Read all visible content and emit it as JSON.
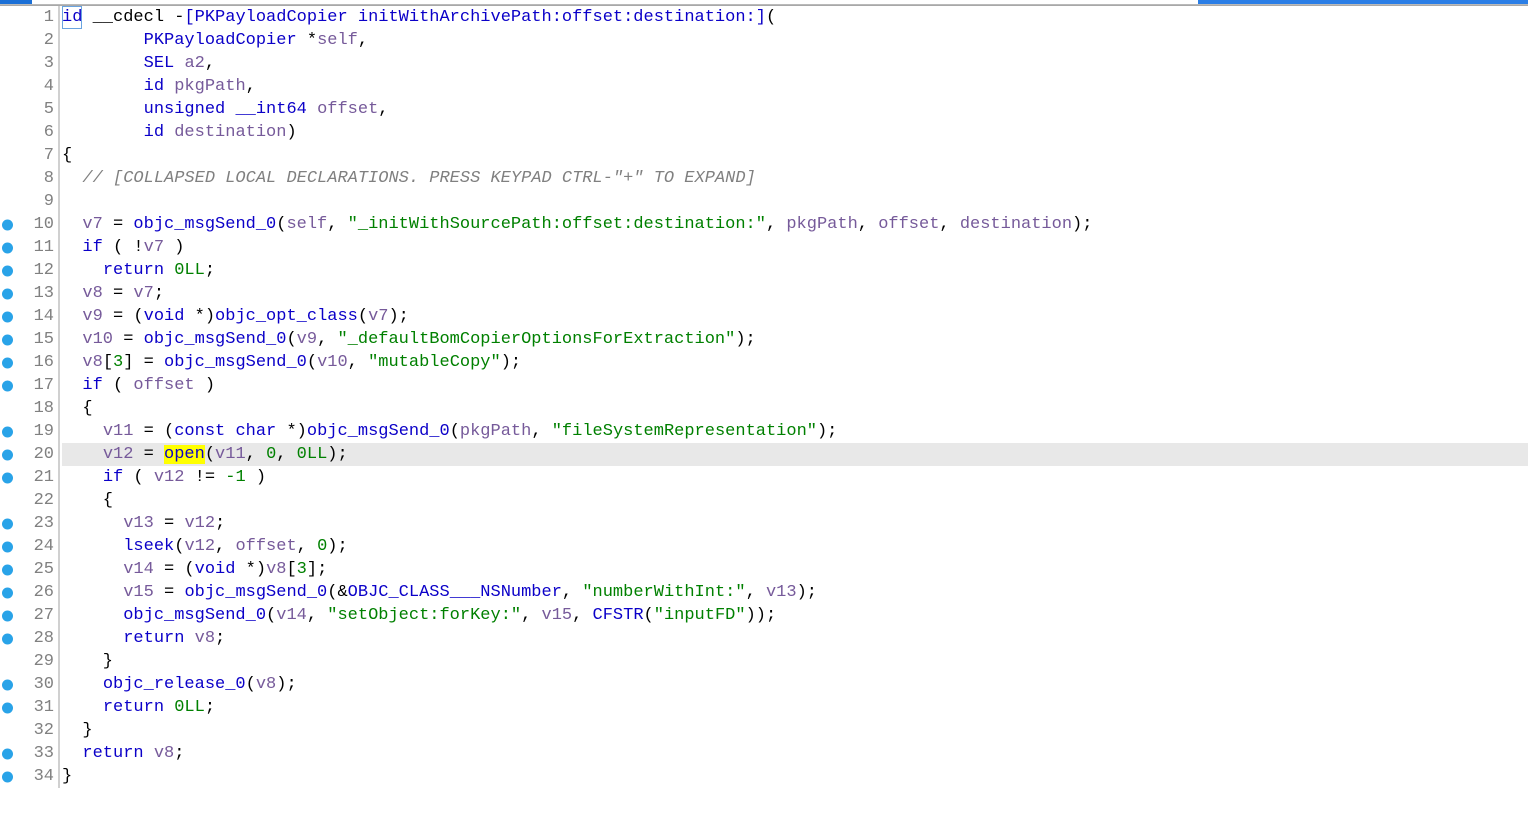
{
  "editor": {
    "current_line": 20,
    "lines": [
      {
        "n": 1,
        "bp": false,
        "tokens": [
          [
            "typ",
            "id"
          ],
          [
            "op",
            " __cdecl "
          ],
          [
            "op",
            "-"
          ],
          [
            "call-blue",
            "[PKPayloadCopier initWithArchivePath:offset:destination:]"
          ],
          [
            "op",
            "("
          ]
        ]
      },
      {
        "n": 2,
        "bp": false,
        "tokens": [
          [
            "op",
            "        "
          ],
          [
            "typ",
            "PKPayloadCopier"
          ],
          [
            "op",
            " *"
          ],
          [
            "var",
            "self"
          ],
          [
            "op",
            ","
          ]
        ]
      },
      {
        "n": 3,
        "bp": false,
        "tokens": [
          [
            "op",
            "        "
          ],
          [
            "typ",
            "SEL"
          ],
          [
            "op",
            " "
          ],
          [
            "var",
            "a2"
          ],
          [
            "op",
            ","
          ]
        ]
      },
      {
        "n": 4,
        "bp": false,
        "tokens": [
          [
            "op",
            "        "
          ],
          [
            "typ",
            "id"
          ],
          [
            "op",
            " "
          ],
          [
            "var",
            "pkgPath"
          ],
          [
            "op",
            ","
          ]
        ]
      },
      {
        "n": 5,
        "bp": false,
        "tokens": [
          [
            "op",
            "        "
          ],
          [
            "kw",
            "unsigned"
          ],
          [
            "op",
            " "
          ],
          [
            "kw",
            "__int64"
          ],
          [
            "op",
            " "
          ],
          [
            "var",
            "offset"
          ],
          [
            "op",
            ","
          ]
        ]
      },
      {
        "n": 6,
        "bp": false,
        "tokens": [
          [
            "op",
            "        "
          ],
          [
            "typ",
            "id"
          ],
          [
            "op",
            " "
          ],
          [
            "var",
            "destination"
          ],
          [
            "op",
            ")"
          ]
        ]
      },
      {
        "n": 7,
        "bp": false,
        "tokens": [
          [
            "op",
            "{"
          ]
        ]
      },
      {
        "n": 8,
        "bp": false,
        "tokens": [
          [
            "op",
            "  "
          ],
          [
            "cmt",
            "// [COLLAPSED LOCAL DECLARATIONS. PRESS KEYPAD CTRL-\"+\" TO EXPAND]"
          ]
        ]
      },
      {
        "n": 9,
        "bp": false,
        "tokens": [
          [
            "op",
            ""
          ]
        ]
      },
      {
        "n": 10,
        "bp": true,
        "tokens": [
          [
            "op",
            "  "
          ],
          [
            "var",
            "v7"
          ],
          [
            "op",
            " = "
          ],
          [
            "call-blue",
            "objc_msgSend_0"
          ],
          [
            "op",
            "("
          ],
          [
            "var",
            "self"
          ],
          [
            "op",
            ", "
          ],
          [
            "str",
            "\"_initWithSourcePath:offset:destination:\""
          ],
          [
            "op",
            ", "
          ],
          [
            "var",
            "pkgPath"
          ],
          [
            "op",
            ", "
          ],
          [
            "var",
            "offset"
          ],
          [
            "op",
            ", "
          ],
          [
            "var",
            "destination"
          ],
          [
            "op",
            ");"
          ]
        ]
      },
      {
        "n": 11,
        "bp": true,
        "tokens": [
          [
            "op",
            "  "
          ],
          [
            "kw",
            "if"
          ],
          [
            "op",
            " ( !"
          ],
          [
            "var",
            "v7"
          ],
          [
            "op",
            " )"
          ]
        ]
      },
      {
        "n": 12,
        "bp": true,
        "tokens": [
          [
            "op",
            "    "
          ],
          [
            "kw",
            "return"
          ],
          [
            "op",
            " "
          ],
          [
            "num",
            "0LL"
          ],
          [
            "op",
            ";"
          ]
        ]
      },
      {
        "n": 13,
        "bp": true,
        "tokens": [
          [
            "op",
            "  "
          ],
          [
            "var",
            "v8"
          ],
          [
            "op",
            " = "
          ],
          [
            "var",
            "v7"
          ],
          [
            "op",
            ";"
          ]
        ]
      },
      {
        "n": 14,
        "bp": true,
        "tokens": [
          [
            "op",
            "  "
          ],
          [
            "var",
            "v9"
          ],
          [
            "op",
            " = ("
          ],
          [
            "kw",
            "void"
          ],
          [
            "op",
            " *)"
          ],
          [
            "call-blue",
            "objc_opt_class"
          ],
          [
            "op",
            "("
          ],
          [
            "var",
            "v7"
          ],
          [
            "op",
            ");"
          ]
        ]
      },
      {
        "n": 15,
        "bp": true,
        "tokens": [
          [
            "op",
            "  "
          ],
          [
            "var",
            "v10"
          ],
          [
            "op",
            " = "
          ],
          [
            "call-blue",
            "objc_msgSend_0"
          ],
          [
            "op",
            "("
          ],
          [
            "var",
            "v9"
          ],
          [
            "op",
            ", "
          ],
          [
            "str",
            "\"_defaultBomCopierOptionsForExtraction\""
          ],
          [
            "op",
            ");"
          ]
        ]
      },
      {
        "n": 16,
        "bp": true,
        "tokens": [
          [
            "op",
            "  "
          ],
          [
            "var",
            "v8"
          ],
          [
            "op",
            "["
          ],
          [
            "num",
            "3"
          ],
          [
            "op",
            "] = "
          ],
          [
            "call-blue",
            "objc_msgSend_0"
          ],
          [
            "op",
            "("
          ],
          [
            "var",
            "v10"
          ],
          [
            "op",
            ", "
          ],
          [
            "str",
            "\"mutableCopy\""
          ],
          [
            "op",
            ");"
          ]
        ]
      },
      {
        "n": 17,
        "bp": true,
        "tokens": [
          [
            "op",
            "  "
          ],
          [
            "kw",
            "if"
          ],
          [
            "op",
            " ( "
          ],
          [
            "var",
            "offset"
          ],
          [
            "op",
            " )"
          ]
        ]
      },
      {
        "n": 18,
        "bp": false,
        "tokens": [
          [
            "op",
            "  {"
          ]
        ]
      },
      {
        "n": 19,
        "bp": true,
        "tokens": [
          [
            "op",
            "    "
          ],
          [
            "var",
            "v11"
          ],
          [
            "op",
            " = ("
          ],
          [
            "kw",
            "const"
          ],
          [
            "op",
            " "
          ],
          [
            "kw",
            "char"
          ],
          [
            "op",
            " *)"
          ],
          [
            "call-blue",
            "objc_msgSend_0"
          ],
          [
            "op",
            "("
          ],
          [
            "var",
            "pkgPath"
          ],
          [
            "op",
            ", "
          ],
          [
            "str",
            "\"fileSystemRepresentation\""
          ],
          [
            "op",
            ");"
          ]
        ]
      },
      {
        "n": 20,
        "bp": true,
        "tokens": [
          [
            "op",
            "    "
          ],
          [
            "var",
            "v12"
          ],
          [
            "op",
            " = "
          ],
          [
            "hl-call",
            "open"
          ],
          [
            "op",
            "("
          ],
          [
            "var",
            "v11"
          ],
          [
            "op",
            ", "
          ],
          [
            "num",
            "0"
          ],
          [
            "op",
            ", "
          ],
          [
            "num",
            "0LL"
          ],
          [
            "op",
            ");"
          ]
        ]
      },
      {
        "n": 21,
        "bp": true,
        "tokens": [
          [
            "op",
            "    "
          ],
          [
            "kw",
            "if"
          ],
          [
            "op",
            " ( "
          ],
          [
            "var",
            "v12"
          ],
          [
            "op",
            " != "
          ],
          [
            "num",
            "-1"
          ],
          [
            "op",
            " )"
          ]
        ]
      },
      {
        "n": 22,
        "bp": false,
        "tokens": [
          [
            "op",
            "    {"
          ]
        ]
      },
      {
        "n": 23,
        "bp": true,
        "tokens": [
          [
            "op",
            "      "
          ],
          [
            "var",
            "v13"
          ],
          [
            "op",
            " = "
          ],
          [
            "var",
            "v12"
          ],
          [
            "op",
            ";"
          ]
        ]
      },
      {
        "n": 24,
        "bp": true,
        "tokens": [
          [
            "op",
            "      "
          ],
          [
            "call-blue",
            "lseek"
          ],
          [
            "op",
            "("
          ],
          [
            "var",
            "v12"
          ],
          [
            "op",
            ", "
          ],
          [
            "var",
            "offset"
          ],
          [
            "op",
            ", "
          ],
          [
            "num",
            "0"
          ],
          [
            "op",
            ");"
          ]
        ]
      },
      {
        "n": 25,
        "bp": true,
        "tokens": [
          [
            "op",
            "      "
          ],
          [
            "var",
            "v14"
          ],
          [
            "op",
            " = ("
          ],
          [
            "kw",
            "void"
          ],
          [
            "op",
            " *)"
          ],
          [
            "var",
            "v8"
          ],
          [
            "op",
            "["
          ],
          [
            "num",
            "3"
          ],
          [
            "op",
            "];"
          ]
        ]
      },
      {
        "n": 26,
        "bp": true,
        "tokens": [
          [
            "op",
            "      "
          ],
          [
            "var",
            "v15"
          ],
          [
            "op",
            " = "
          ],
          [
            "call-blue",
            "objc_msgSend_0"
          ],
          [
            "op",
            "(&"
          ],
          [
            "glob",
            "OBJC_CLASS___NSNumber"
          ],
          [
            "op",
            ", "
          ],
          [
            "str",
            "\"numberWithInt:\""
          ],
          [
            "op",
            ", "
          ],
          [
            "var",
            "v13"
          ],
          [
            "op",
            ");"
          ]
        ]
      },
      {
        "n": 27,
        "bp": true,
        "tokens": [
          [
            "op",
            "      "
          ],
          [
            "call-blue",
            "objc_msgSend_0"
          ],
          [
            "op",
            "("
          ],
          [
            "var",
            "v14"
          ],
          [
            "op",
            ", "
          ],
          [
            "str",
            "\"setObject:forKey:\""
          ],
          [
            "op",
            ", "
          ],
          [
            "var",
            "v15"
          ],
          [
            "op",
            ", "
          ],
          [
            "call-blue",
            "CFSTR"
          ],
          [
            "op",
            "("
          ],
          [
            "str",
            "\"inputFD\""
          ],
          [
            "op",
            "));"
          ]
        ]
      },
      {
        "n": 28,
        "bp": true,
        "tokens": [
          [
            "op",
            "      "
          ],
          [
            "kw",
            "return"
          ],
          [
            "op",
            " "
          ],
          [
            "var",
            "v8"
          ],
          [
            "op",
            ";"
          ]
        ]
      },
      {
        "n": 29,
        "bp": false,
        "tokens": [
          [
            "op",
            "    }"
          ]
        ]
      },
      {
        "n": 30,
        "bp": true,
        "tokens": [
          [
            "op",
            "    "
          ],
          [
            "call-blue",
            "objc_release_0"
          ],
          [
            "op",
            "("
          ],
          [
            "var",
            "v8"
          ],
          [
            "op",
            ");"
          ]
        ]
      },
      {
        "n": 31,
        "bp": true,
        "tokens": [
          [
            "op",
            "    "
          ],
          [
            "kw",
            "return"
          ],
          [
            "op",
            " "
          ],
          [
            "num",
            "0LL"
          ],
          [
            "op",
            ";"
          ]
        ]
      },
      {
        "n": 32,
        "bp": false,
        "tokens": [
          [
            "op",
            "  }"
          ]
        ]
      },
      {
        "n": 33,
        "bp": true,
        "tokens": [
          [
            "op",
            "  "
          ],
          [
            "kw",
            "return"
          ],
          [
            "op",
            " "
          ],
          [
            "var",
            "v8"
          ],
          [
            "op",
            ";"
          ]
        ]
      },
      {
        "n": 34,
        "bp": true,
        "tokens": [
          [
            "op",
            "}"
          ]
        ]
      }
    ]
  }
}
